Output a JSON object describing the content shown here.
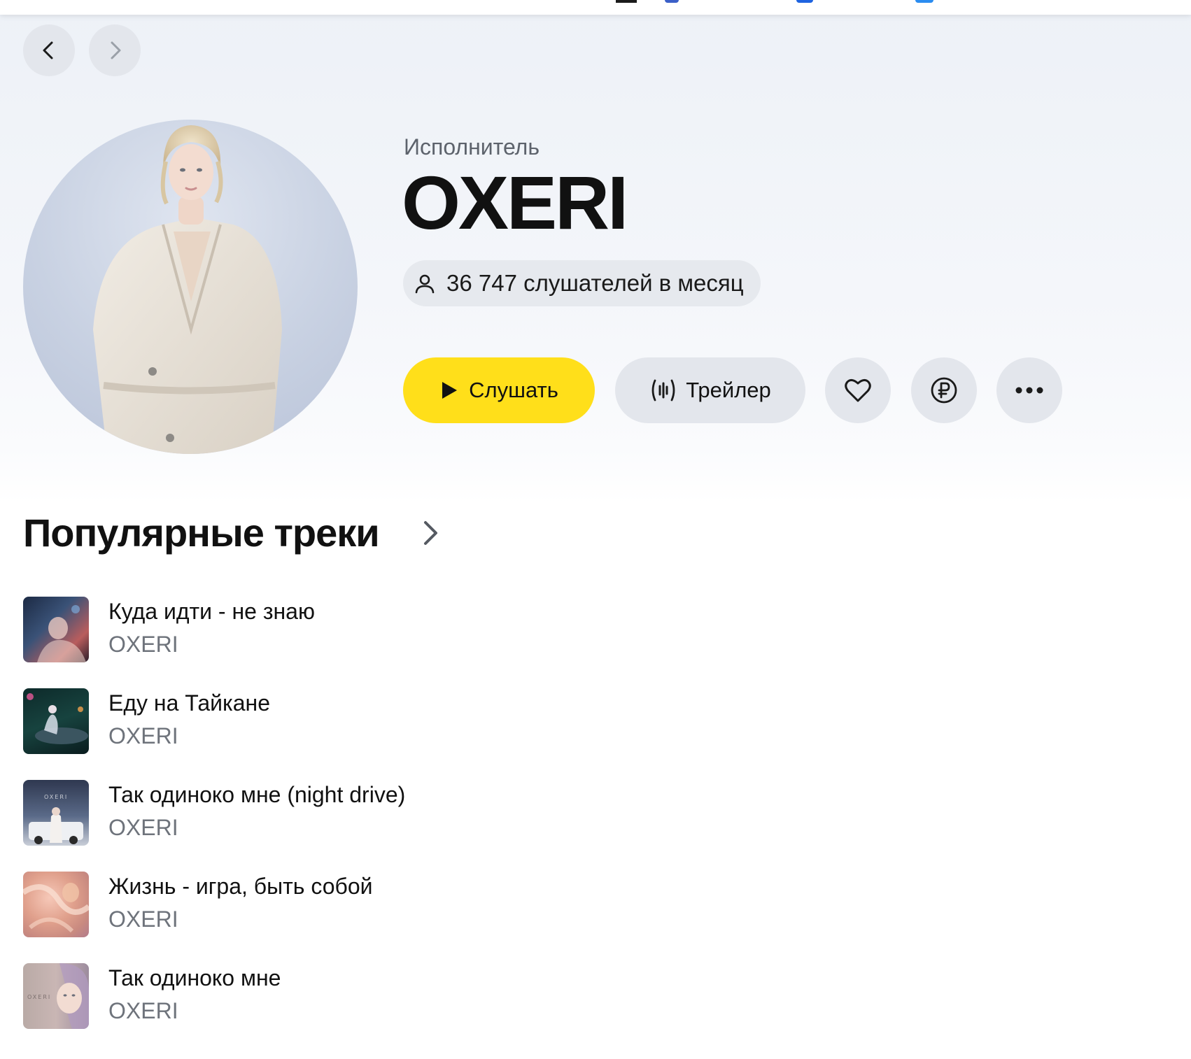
{
  "artist": {
    "label": "Исполнитель",
    "name": "OXERI",
    "listeners": "36 747 слушателей в месяц"
  },
  "actions": {
    "listen_label": "Слушать",
    "trailer_label": "Трейлер"
  },
  "icons": {
    "back": "chevron-left-icon",
    "forward": "chevron-right-icon",
    "listeners": "person-icon",
    "play": "play-icon",
    "trailer": "audio-wave-icon",
    "like": "heart-icon",
    "donate": "ruble-icon",
    "more": "ellipsis-icon"
  },
  "colors": {
    "accent": "#ffdf1a",
    "button_bg": "#e3e6ec",
    "secondary_text": "#6e737b"
  },
  "popular": {
    "title": "Популярные треки",
    "tracks": [
      {
        "title": "Куда идти - не знаю",
        "artist": "OXERI"
      },
      {
        "title": "Еду на Тайкане",
        "artist": "OXERI"
      },
      {
        "title": "Так одиноко мне (night drive)",
        "artist": "OXERI",
        "cover_text": "OXERI"
      },
      {
        "title": "Жизнь - игра, быть собой",
        "artist": "OXERI"
      },
      {
        "title": "Так одиноко мне",
        "artist": "OXERI",
        "cover_text": "OXERI"
      }
    ]
  }
}
